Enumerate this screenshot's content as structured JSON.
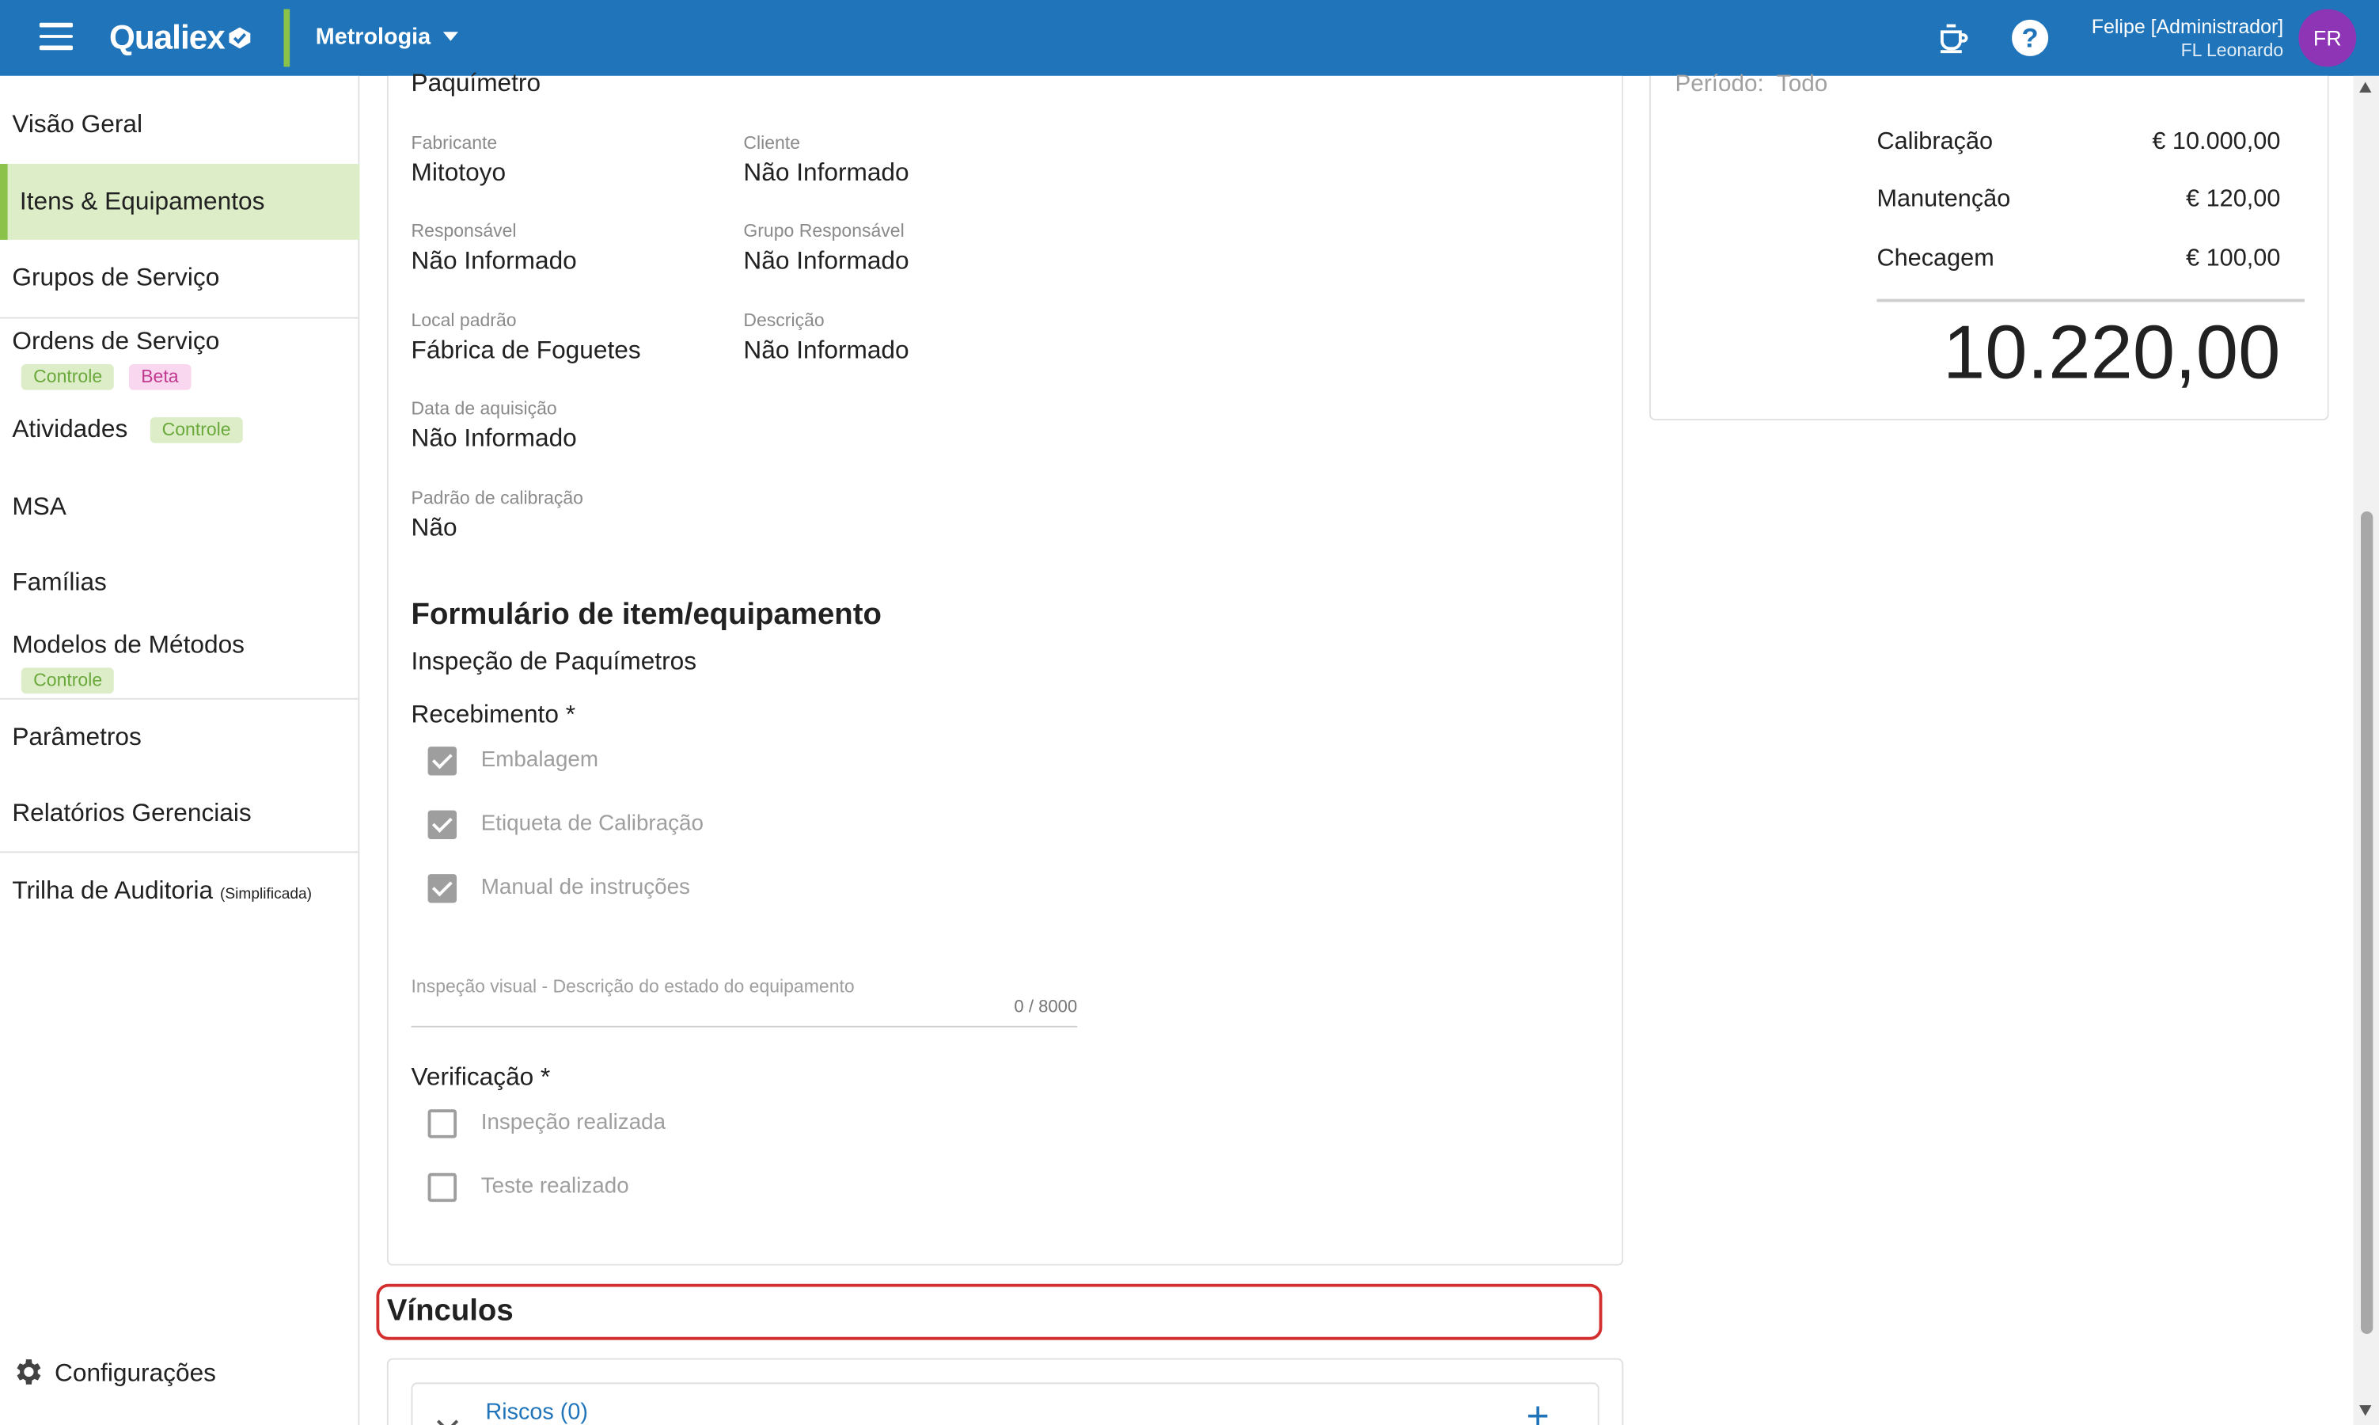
{
  "topbar": {
    "logo": "Qualiex",
    "module": "Metrologia",
    "user_name": "Felipe [Administrador]",
    "user_sub": "FL Leonardo",
    "avatar_initials": "FR",
    "icons": [
      "menu-icon",
      "coffee-cup-icon",
      "help-icon"
    ],
    "colors": {
      "bar": "#1f74ba",
      "accent": "#8bc34a",
      "avatar": "#8e35b5"
    }
  },
  "sidebar": {
    "items": [
      {
        "label": "Visão Geral"
      },
      {
        "label": "Itens & Equipamentos",
        "active": true
      },
      {
        "label": "Grupos de Serviço"
      },
      {
        "label": "Ordens de Serviço",
        "tags": [
          "Controle",
          "Beta"
        ]
      },
      {
        "label": "Atividades",
        "tags": [
          "Controle"
        ]
      },
      {
        "label": "MSA"
      },
      {
        "label": "Famílias"
      },
      {
        "label": "Modelos de Métodos",
        "tags": [
          "Controle"
        ]
      },
      {
        "label": "Parâmetros"
      },
      {
        "label": "Relatórios Gerenciais"
      },
      {
        "label": "Trilha de Auditoria",
        "note": "(Simplificada)"
      }
    ],
    "footer": {
      "label": "Configurações",
      "icon": "gear-icon"
    }
  },
  "details": {
    "top_value": "Paquímetro",
    "fields": [
      {
        "label": "Fabricante",
        "value": "Mitotoyo"
      },
      {
        "label": "Cliente",
        "value": "Não Informado"
      },
      {
        "label": "Responsável",
        "value": "Não Informado"
      },
      {
        "label": "Grupo Responsável",
        "value": "Não Informado"
      },
      {
        "label": "Local padrão",
        "value": "Fábrica de Foguetes"
      },
      {
        "label": "Descrição",
        "value": "Não Informado"
      },
      {
        "label": "Data de aquisição",
        "value": "Não Informado"
      },
      {
        "label": "Padrão de calibração",
        "value": "Não"
      }
    ]
  },
  "form": {
    "title": "Formulário de item/equipamento",
    "subtitle": "Inspeção de Paquímetros",
    "recebimento": {
      "label": "Recebimento *",
      "options": [
        {
          "label": "Embalagem",
          "checked": true
        },
        {
          "label": "Etiqueta de Calibração",
          "checked": true
        },
        {
          "label": "Manual de instruções",
          "checked": true
        }
      ]
    },
    "textarea": {
      "label": "Inspeção visual - Descrição do estado do equipamento",
      "counter": "0 / 8000",
      "value": ""
    },
    "verificacao": {
      "label": "Verificação *",
      "options": [
        {
          "label": "Inspeção realizada",
          "checked": false
        },
        {
          "label": "Teste realizado",
          "checked": false
        }
      ]
    }
  },
  "vinculos": {
    "title": "Vínculos",
    "riscos": "Riscos (0)",
    "add_symbol": "+"
  },
  "costs": {
    "periodo_label": "Período:",
    "periodo_value": "Todo",
    "rows": [
      {
        "label": "Calibração",
        "value": "€ 10.000,00"
      },
      {
        "label": "Manutenção",
        "value": "€ 120,00"
      },
      {
        "label": "Checagem",
        "value": "€ 100,00"
      }
    ],
    "total": "10.220,00"
  }
}
